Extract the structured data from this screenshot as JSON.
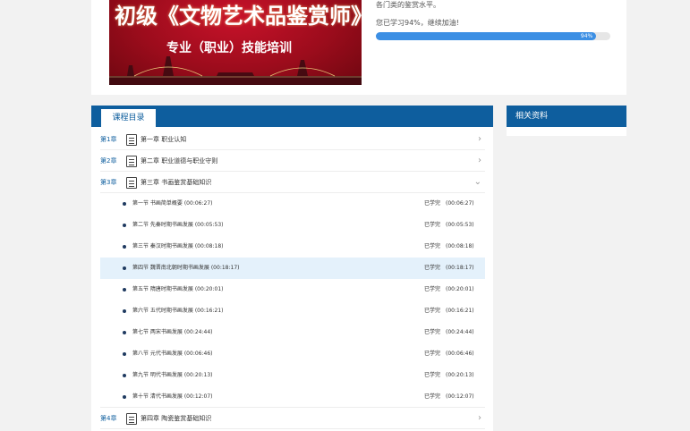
{
  "banner": {
    "title": "初级《文物艺术品鉴赏师》",
    "subtitle": "专业（职业）技能培训"
  },
  "course": {
    "intro_tail": "各门类的鉴赏水平。",
    "progress_text": "您已学习94%，继续加油!",
    "progress_label": "94%",
    "progress_value": 0.94
  },
  "catalog": {
    "tab_label": "课程目录",
    "chapters": [
      {
        "num": "第1章",
        "title": "第一章 职业认知"
      },
      {
        "num": "第2章",
        "title": "第二章 职业道德与职业守则"
      },
      {
        "num": "第3章",
        "title": "第三章 书画鉴赏基础知识"
      },
      {
        "num": "第4章",
        "title": "第四章 陶瓷鉴赏基础知识"
      }
    ],
    "sections": [
      {
        "title": "第一节 书画简单概要",
        "duration": "(00:06:27)",
        "status": "已学完",
        "total": "(00:06:27)"
      },
      {
        "title": "第二节 先秦时期书画发展",
        "duration": "(00:05:53)",
        "status": "已学完",
        "total": "(00:05:53)"
      },
      {
        "title": "第三节 秦汉时期书画发展",
        "duration": "(00:08:18)",
        "status": "已学完",
        "total": "(00:08:18)"
      },
      {
        "title": "第四节 魏晋南北朝时期书画发展",
        "duration": "(00:18:17)",
        "status": "已学完",
        "total": "(00:18:17)"
      },
      {
        "title": "第五节 隋唐时期书画发展",
        "duration": "(00:20:01)",
        "status": "已学完",
        "total": "(00:20:01)"
      },
      {
        "title": "第六节 五代时期书画发展",
        "duration": "(00:16:21)",
        "status": "已学完",
        "total": "(00:16:21)"
      },
      {
        "title": "第七节 两宋书画发展",
        "duration": "(00:24:44)",
        "status": "已学完",
        "total": "(00:24:44)"
      },
      {
        "title": "第八节 元代书画发展",
        "duration": "(00:06:46)",
        "status": "已学完",
        "total": "(00:06:46)"
      },
      {
        "title": "第九节 明代书画发展",
        "duration": "(00:20:13)",
        "status": "已学完",
        "total": "(00:20:13)"
      },
      {
        "title": "第十节 清代书画发展",
        "duration": "(00:12:07)",
        "status": "已学完",
        "total": "(00:12:07)"
      }
    ]
  },
  "related": {
    "title": "相关资料"
  }
}
